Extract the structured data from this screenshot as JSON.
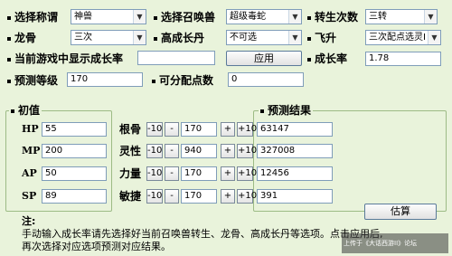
{
  "top": {
    "row1": {
      "title_label": "选择称谓",
      "title_value": "神兽",
      "summon_label": "选择召唤兽",
      "summon_value": "超级毒蛇",
      "rebirth_label": "转生次数",
      "rebirth_value": "三转"
    },
    "row2": {
      "dragon_label": "龙骨",
      "dragon_value": "三次",
      "advdan_label": "高成长丹",
      "advdan_value": "不可选",
      "fly_label": "飞升",
      "fly_value": "三次配点选灵I"
    },
    "row3": {
      "current_label": "当前游戏中显示成长率",
      "current_value": "",
      "apply_label": "应用",
      "growth_label": "成长率",
      "growth_value": "1.78"
    },
    "row4": {
      "level_label": "预测等级",
      "level_value": "170",
      "points_label": "可分配点数",
      "points_value": "0"
    }
  },
  "initial": {
    "label": "初值",
    "stats": [
      {
        "name": "HP",
        "value": "55"
      },
      {
        "name": "MP",
        "value": "200"
      },
      {
        "name": "AP",
        "value": "50"
      },
      {
        "name": "SP",
        "value": "89"
      }
    ]
  },
  "attributes": [
    {
      "name": "根骨",
      "value": "170"
    },
    {
      "name": "灵性",
      "value": "940"
    },
    {
      "name": "力量",
      "value": "170"
    },
    {
      "name": "敏捷",
      "value": "170"
    }
  ],
  "buttons": {
    "minus10": "-10",
    "minus": "-",
    "plus": "+",
    "plus10": "+10"
  },
  "results": {
    "label": "预测结果",
    "values": [
      "63147",
      "327008",
      "12456",
      "391"
    ],
    "estimate_label": "估算"
  },
  "note": {
    "title": "注:",
    "line1": "手动输入成长率请先选择好当前召唤兽转生、龙骨、高成长丹等选项。点击应用后,",
    "line2": "再次选择对应选项预测对应结果。"
  },
  "watermark": "上传于《大话西游II》论坛"
}
